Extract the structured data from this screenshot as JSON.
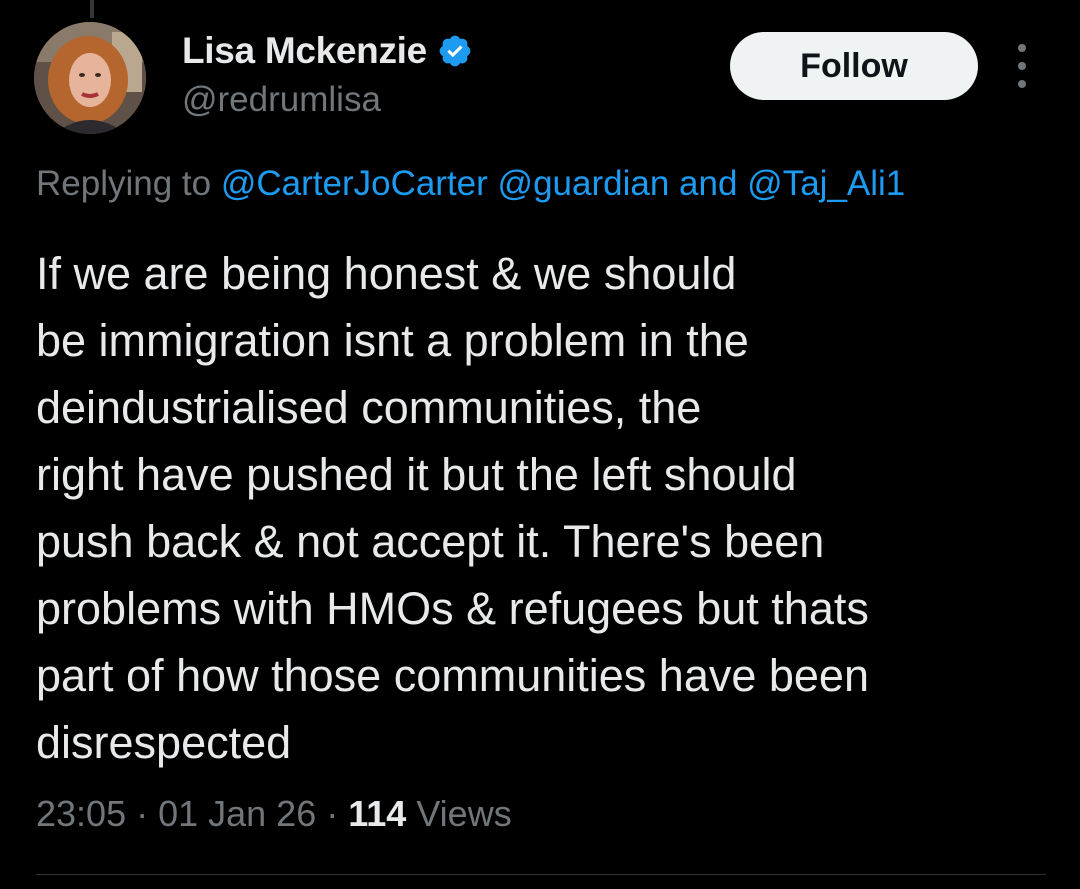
{
  "author": {
    "display_name": "Lisa Mckenzie",
    "handle": "@redrumlisa",
    "verified": true,
    "avatar_icon": "profile-photo"
  },
  "actions": {
    "follow_label": "Follow",
    "more_icon": "more-vertical-icon"
  },
  "reply": {
    "prefix": "Replying to ",
    "mention_1": "@CarterJoCarter",
    "mention_2": "@guardian",
    "conjunction": " and ",
    "mention_3": "@Taj_Ali1"
  },
  "tweet": {
    "lines": [
      "If we are being honest & we should",
      "be immigration isnt a problem in the",
      "deindustrialised communities, the",
      "right have pushed it but the left should",
      "push back & not accept it. There's been",
      "problems with HMOs & refugees but thats",
      "part of how those communities have been",
      "disrespected"
    ]
  },
  "meta": {
    "time": "23:05",
    "separator": " · ",
    "date": "01 Jan 26",
    "views_count": "114",
    "views_label": " Views"
  },
  "colors": {
    "background": "#000000",
    "text_primary": "#e7e9ea",
    "text_secondary": "#71767b",
    "accent": "#1d9bf0",
    "follow_bg": "#eff3f4"
  }
}
